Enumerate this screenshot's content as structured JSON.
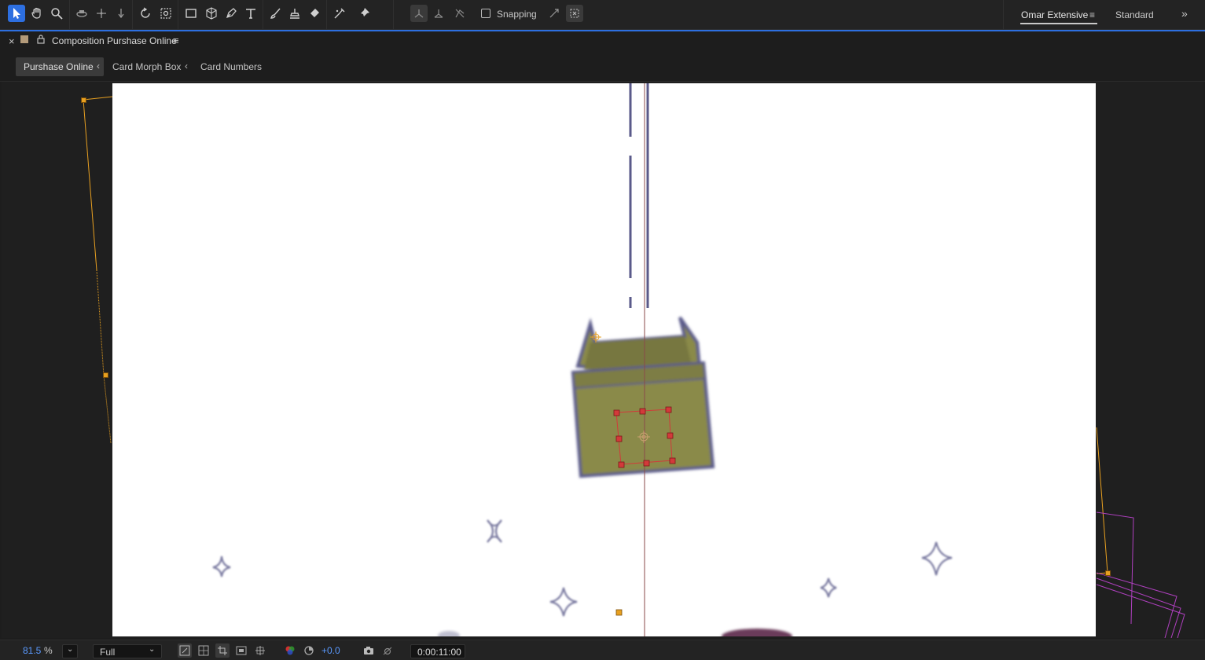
{
  "toolbar": {
    "tools": [
      "selection-tool",
      "hand-tool",
      "zoom-tool",
      "orbit-camera-tool",
      "pan-camera-tool",
      "dolly-camera-tool",
      "rotation-tool",
      "pan-behind-tool",
      "rectangle-tool",
      "extrude-tool",
      "pen-tool",
      "type-tool",
      "brush-tool",
      "clone-stamp-tool",
      "eraser-tool",
      "roto-brush-tool",
      "puppet-pin-tool"
    ],
    "snapping_label": "Snapping",
    "snapping_checked": false
  },
  "workspaces": {
    "active": "Omar Extensive",
    "other": "Standard"
  },
  "panel": {
    "close": "×",
    "title": "Composition Purshase Online",
    "menu": "≡"
  },
  "breadcrumbs": [
    {
      "label": "Purshase Online"
    },
    {
      "label": "Card Morph Box"
    },
    {
      "label": "Card Numbers"
    }
  ],
  "chevron": "‹",
  "statusbar": {
    "zoom_value": "81.5",
    "zoom_unit": "%",
    "resolution": "Full",
    "exposure": "+0.0",
    "timecode": "0:00:11:00"
  },
  "colors": {
    "accent": "#2d6fe0",
    "anchor_orange": "#e8a020",
    "box_olive": "#8a8a4a",
    "box_outline": "#5a5a8a",
    "handle_red": "#d23a3a",
    "magenta": "#b040c0"
  }
}
